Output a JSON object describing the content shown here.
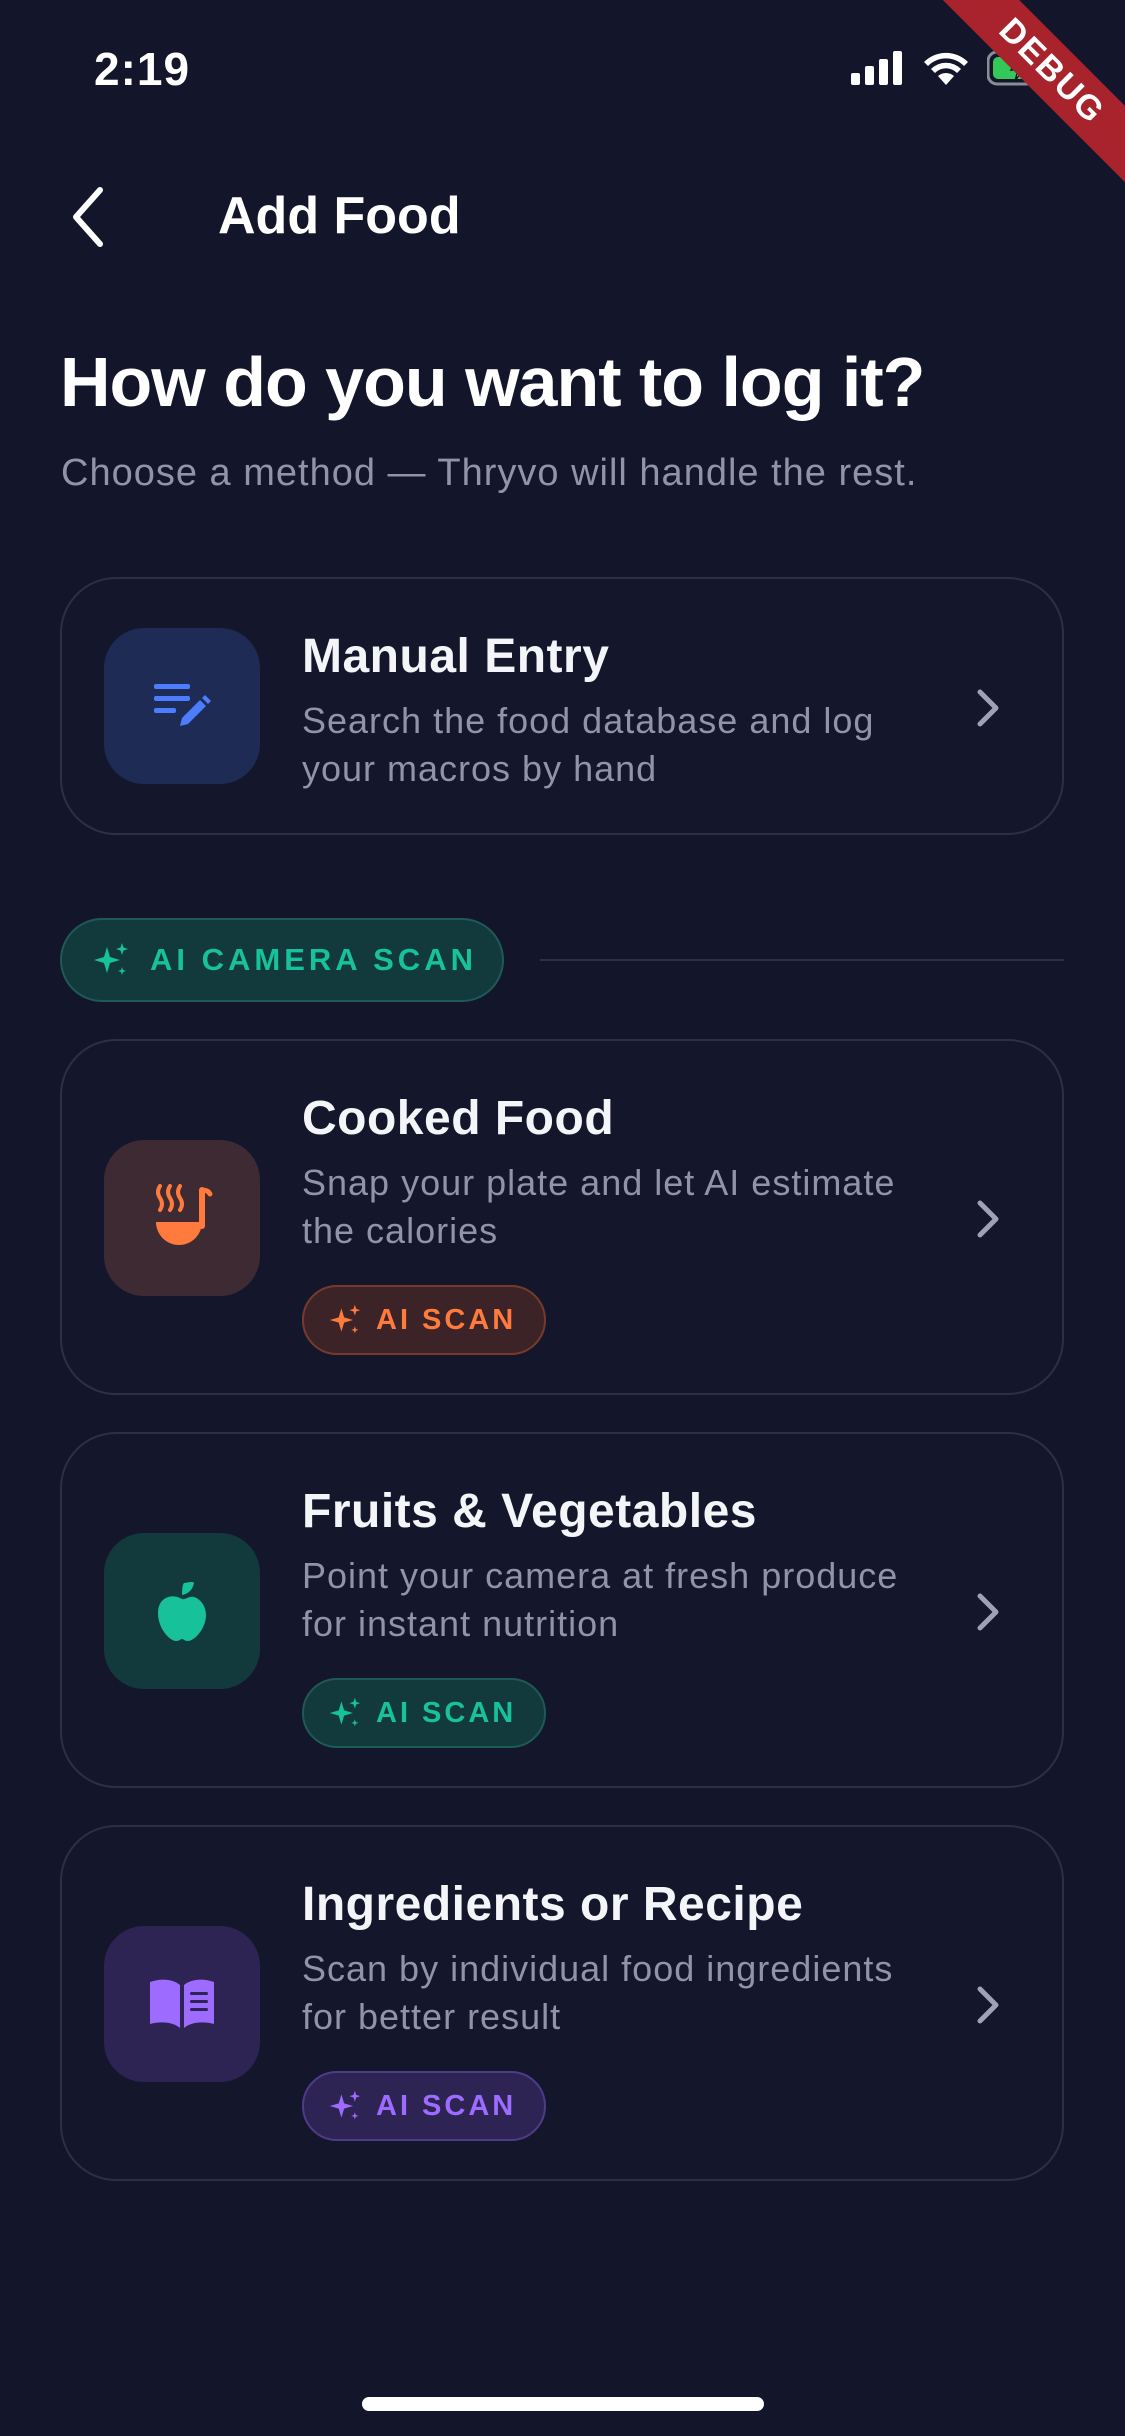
{
  "status_bar": {
    "time": "2:19",
    "debug_label": "DEBUG"
  },
  "nav": {
    "title": "Add Food"
  },
  "heading": {
    "title": "How do you want to log it?",
    "subtitle": "Choose a method — Thryvo will handle the rest."
  },
  "manual_entry": {
    "title": "Manual Entry",
    "description": "Search the food database and log your macros by hand",
    "icon": "edit-list-icon",
    "accent": "#4d7dff"
  },
  "section": {
    "label": "AI CAMERA SCAN",
    "accent": "#17c29a"
  },
  "cards": [
    {
      "title": "Cooked Food",
      "description": "Snap your plate and let AI estimate the calories",
      "badge": "AI SCAN",
      "icon": "ladle-steam-icon",
      "accent": "#ff7a3d"
    },
    {
      "title": "Fruits & Vegetables",
      "description": "Point your camera at fresh produce for instant nutrition",
      "badge": "AI SCAN",
      "icon": "apple-icon",
      "accent": "#17c29a"
    },
    {
      "title": "Ingredients or Recipe",
      "description": "Scan by individual food ingredients for better result",
      "badge": "AI SCAN",
      "icon": "recipe-book-icon",
      "accent": "#9d6bff"
    }
  ]
}
